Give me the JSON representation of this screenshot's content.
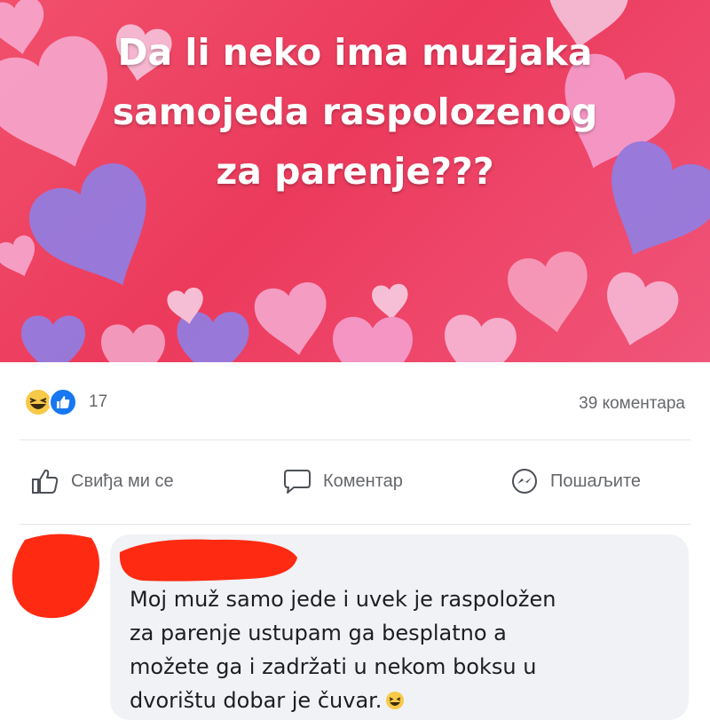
{
  "post": {
    "text_lines": [
      "Da li neko ima muzjaka",
      "samojeda raspolozenog",
      "za parenje???"
    ]
  },
  "reactions": {
    "count": "17",
    "comments_count": "39 коментара",
    "icons": [
      "haha-icon",
      "like-icon"
    ]
  },
  "actions": {
    "like_label": "Свиђа ми се",
    "comment_label": "Коментар",
    "share_label": "Пошаљите"
  },
  "comment": {
    "lines": [
      "Moj muž samo jede i uvek je raspoložen",
      "za parenje ustupam ga besplatno a",
      "možete ga i zadržati u nekom boksu u",
      "dvorištu dobar je čuvar."
    ],
    "emoji": "laughing-emoji-icon"
  },
  "colors": {
    "post_background": "#ec3a5c",
    "secondary_text": "#65676b",
    "comment_bubble": "#f0f2f5",
    "redaction": "#ff2a12",
    "like_blue": "#1877f2"
  }
}
